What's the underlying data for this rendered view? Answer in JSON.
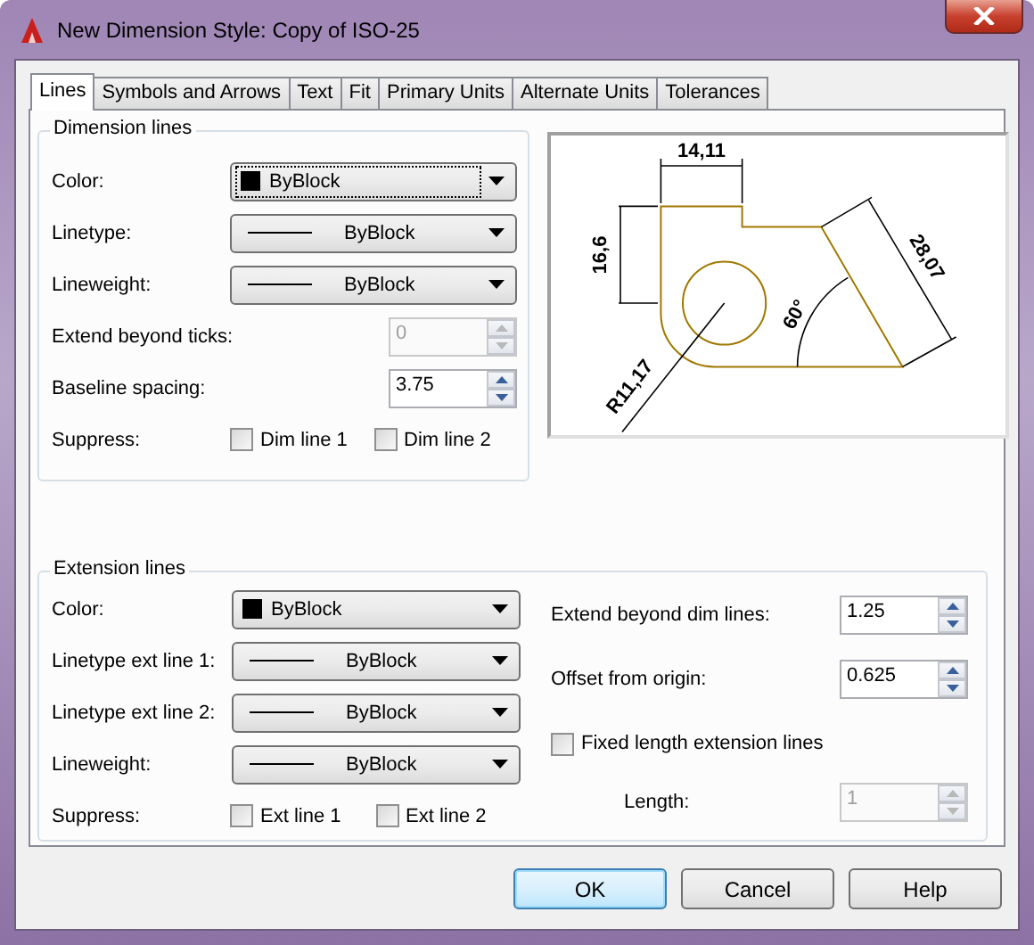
{
  "window": {
    "title": "New Dimension Style: Copy of ISO-25"
  },
  "tabs": [
    {
      "label": "Lines",
      "selected": true
    },
    {
      "label": "Symbols and Arrows",
      "selected": false
    },
    {
      "label": "Text",
      "selected": false
    },
    {
      "label": "Fit",
      "selected": false
    },
    {
      "label": "Primary Units",
      "selected": false
    },
    {
      "label": "Alternate Units",
      "selected": false
    },
    {
      "label": "Tolerances",
      "selected": false
    }
  ],
  "dimension_lines": {
    "title": "Dimension lines",
    "rows": [
      {
        "kind": "color",
        "label": "Color:",
        "value": "ByBlock",
        "focused": true
      },
      {
        "kind": "linetype",
        "label": "Linetype:",
        "value": "ByBlock",
        "focused": false
      },
      {
        "kind": "linetype",
        "label": "Lineweight:",
        "value": "ByBlock",
        "focused": false
      },
      {
        "kind": "spin",
        "label": "Extend beyond ticks:",
        "value": "0",
        "disabled": true
      },
      {
        "kind": "spin",
        "label": "Baseline spacing:",
        "value": "3.75",
        "disabled": false
      },
      {
        "kind": "checks",
        "label": "Suppress:",
        "options": [
          {
            "label": "Dim line 1",
            "checked": false
          },
          {
            "label": "Dim line 2",
            "checked": false
          }
        ]
      }
    ]
  },
  "preview": {
    "labels": [
      {
        "text": "14,11"
      },
      {
        "text": "16,6"
      },
      {
        "text": "28,07"
      },
      {
        "text": "60°"
      },
      {
        "text": "R11,17"
      }
    ]
  },
  "extension_lines": {
    "title": "Extension lines",
    "left_rows": [
      {
        "kind": "color",
        "label": "Color:",
        "value": "ByBlock",
        "focused": false
      },
      {
        "kind": "linetype",
        "label": "Linetype ext line 1:",
        "value": "ByBlock",
        "focused": false
      },
      {
        "kind": "linetype",
        "label": "Linetype ext line 2:",
        "value": "ByBlock",
        "focused": false
      },
      {
        "kind": "linetype",
        "label": "Lineweight:",
        "value": "ByBlock",
        "focused": false
      },
      {
        "kind": "checks",
        "label": "Suppress:",
        "options": [
          {
            "label": "Ext line 1",
            "checked": false
          },
          {
            "label": "Ext line 2",
            "checked": false
          }
        ]
      }
    ],
    "right_rows": [
      {
        "kind": "spin",
        "label": "Extend beyond dim lines:",
        "value": "1.25",
        "disabled": false
      },
      {
        "kind": "spin",
        "label": "Offset from origin:",
        "value": "0.625",
        "disabled": false
      },
      {
        "kind": "check",
        "label": "Fixed length extension lines",
        "checked": false,
        "children": [
          {
            "kind": "spin",
            "label": "Length:",
            "value": "1",
            "disabled": true
          }
        ]
      }
    ]
  },
  "buttons": [
    {
      "label": "OK",
      "default": true
    },
    {
      "label": "Cancel",
      "default": false
    },
    {
      "label": "Help",
      "default": false
    }
  ]
}
